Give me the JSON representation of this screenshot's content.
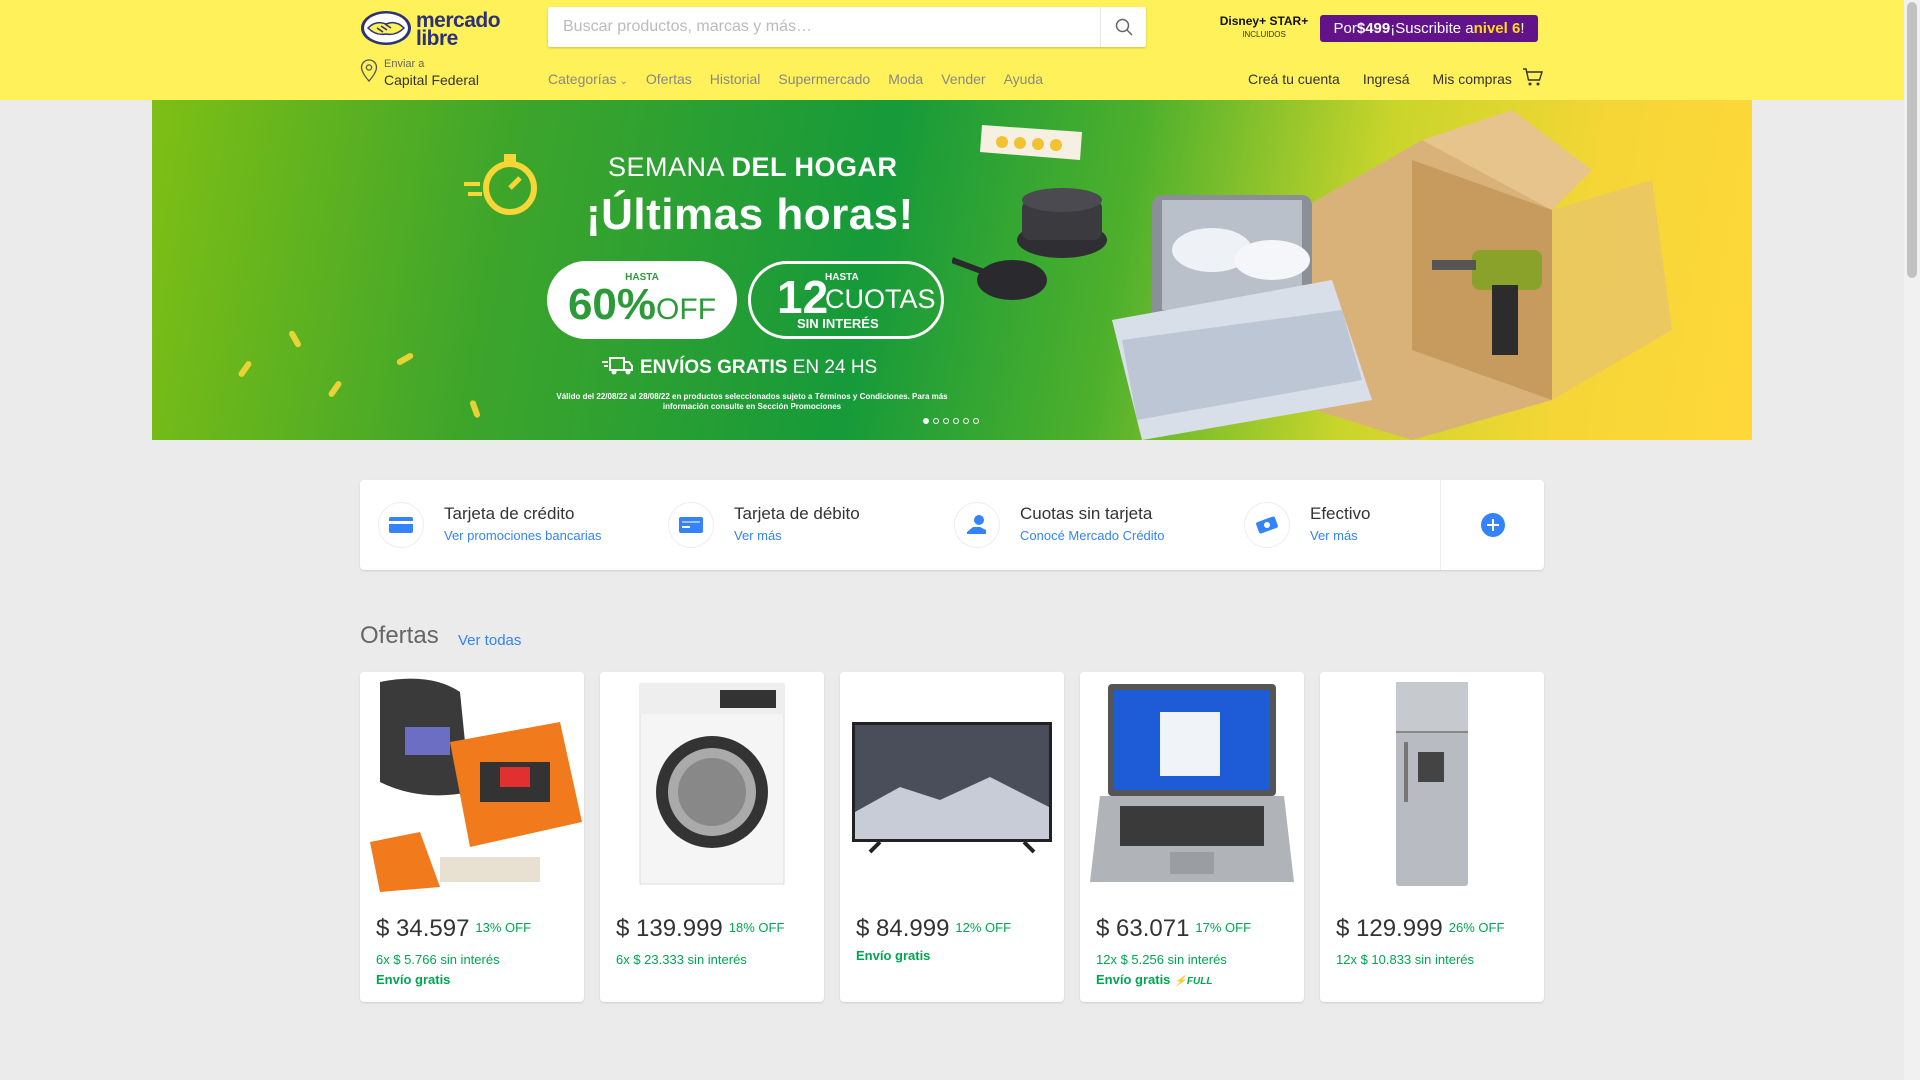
{
  "header": {
    "logo_text_line1": "mercado",
    "logo_text_line2": "libre",
    "search_placeholder": "Buscar productos, marcas y más…",
    "disney_label": "Disney+ STAR+",
    "disney_sub": "INCLUIDOS",
    "promo_pre": "Por ",
    "promo_price": "$499",
    "promo_mid": " ¡Suscribite a ",
    "promo_level": "nivel 6",
    "promo_end": "!",
    "location_top": "Enviar a",
    "location_bottom": "Capital Federal",
    "nav": [
      "Categorías",
      "Ofertas",
      "Historial",
      "Supermercado",
      "Moda",
      "Vender",
      "Ayuda"
    ],
    "right_nav": [
      "Creá tu cuenta",
      "Ingresá",
      "Mis compras"
    ],
    "accent": "#fff159"
  },
  "banner": {
    "title1_a": "SEMANA ",
    "title1_b": "DEL HOGAR",
    "title2": "¡Últimas horas!",
    "pill1_head": "HASTA",
    "pill1_value": "60%",
    "pill1_suffix": "OFF",
    "pill2_num": "12",
    "pill2_head": "HASTA",
    "pill2_unit": "CUOTAS",
    "pill2_sub": "SIN INTERÉS",
    "ship_bold": "ENVÍOS GRATIS",
    "ship_rest": " EN 24 HS",
    "legal": "Válido del 22/08/22 al 28/08/22 en productos seleccionados sujeto a Términos y Condiciones. Para más información consulte en Sección Promociones",
    "slides": 6,
    "active_slide": 1
  },
  "payments": [
    {
      "title": "Tarjeta de crédito",
      "link": "Ver promociones bancarias",
      "icon": "credit-card-icon"
    },
    {
      "title": "Tarjeta de débito",
      "link": "Ver más",
      "icon": "debit-card-icon"
    },
    {
      "title": "Cuotas sin tarjeta",
      "link": "Conocé Mercado Crédito",
      "icon": "hand-coin-icon"
    },
    {
      "title": "Efectivo",
      "link": "Ver más",
      "icon": "cash-icon"
    }
  ],
  "offers": {
    "title": "Ofertas",
    "link": "Ver todas",
    "items": [
      {
        "product": "welding-kit",
        "price": "$ 34.597",
        "discount": "13% OFF",
        "installments": "6x $ 5.766 sin interés",
        "shipping": "Envío gratis"
      },
      {
        "product": "washing-machine",
        "price": "$ 139.999",
        "discount": "18% OFF",
        "installments": "6x $ 23.333 sin interés",
        "shipping": ""
      },
      {
        "product": "television",
        "price": "$ 84.999",
        "discount": "12% OFF",
        "installments": "",
        "shipping": "Envío gratis"
      },
      {
        "product": "laptop",
        "price": "$ 63.071",
        "discount": "17% OFF",
        "installments": "12x $ 5.256 sin interés",
        "shipping": "Envío gratis",
        "full": "FULL"
      },
      {
        "product": "refrigerator",
        "price": "$ 129.999",
        "discount": "26% OFF",
        "installments": "12x $ 10.833 sin interés",
        "shipping": ""
      }
    ]
  }
}
